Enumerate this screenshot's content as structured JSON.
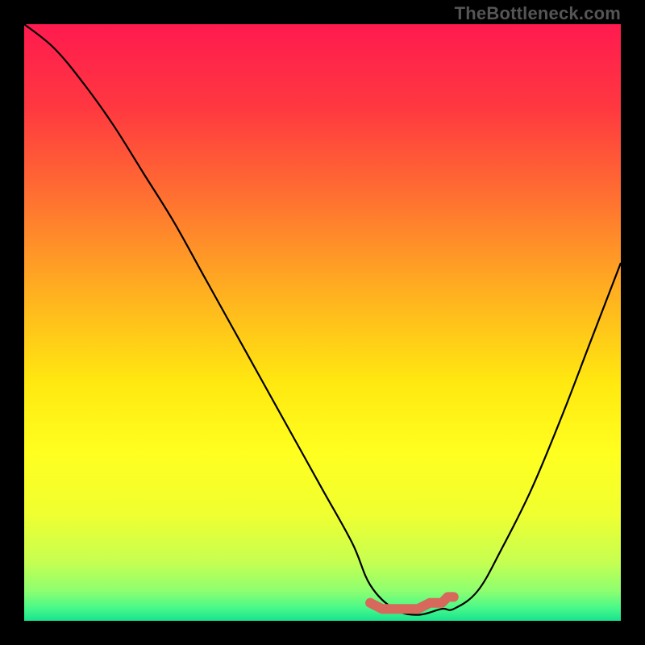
{
  "watermark": "TheBottleneck.com",
  "chart_data": {
    "type": "line",
    "title": "",
    "xlabel": "",
    "ylabel": "",
    "xlim": [
      0,
      100
    ],
    "ylim": [
      0,
      100
    ],
    "grid": false,
    "series": [
      {
        "name": "bottleneck-curve",
        "x": [
          0,
          5,
          10,
          15,
          20,
          25,
          30,
          35,
          40,
          45,
          50,
          55,
          58,
          62,
          66,
          70,
          72,
          76,
          80,
          85,
          90,
          95,
          100
        ],
        "values": [
          100,
          96,
          90,
          83,
          75,
          67,
          58,
          49,
          40,
          31,
          22,
          13,
          6,
          2,
          1,
          2,
          2,
          5,
          12,
          22,
          34,
          47,
          60
        ]
      },
      {
        "name": "optimal-marker",
        "x": [
          58,
          60,
          62,
          64,
          66,
          68,
          70,
          71,
          72
        ],
        "values": [
          3,
          2,
          2,
          2,
          2,
          3,
          3,
          4,
          4
        ]
      }
    ],
    "gradient_stops": [
      {
        "pos": 0.0,
        "color": "#ff1a4f"
      },
      {
        "pos": 0.14,
        "color": "#ff3840"
      },
      {
        "pos": 0.3,
        "color": "#ff7430"
      },
      {
        "pos": 0.45,
        "color": "#ffb020"
      },
      {
        "pos": 0.6,
        "color": "#ffe810"
      },
      {
        "pos": 0.72,
        "color": "#ffff20"
      },
      {
        "pos": 0.82,
        "color": "#f0ff30"
      },
      {
        "pos": 0.9,
        "color": "#c7ff50"
      },
      {
        "pos": 0.95,
        "color": "#8dff70"
      },
      {
        "pos": 0.98,
        "color": "#45f88a"
      },
      {
        "pos": 1.0,
        "color": "#18e28e"
      }
    ],
    "curve_color": "#000000",
    "marker_color": "#d8675c"
  }
}
